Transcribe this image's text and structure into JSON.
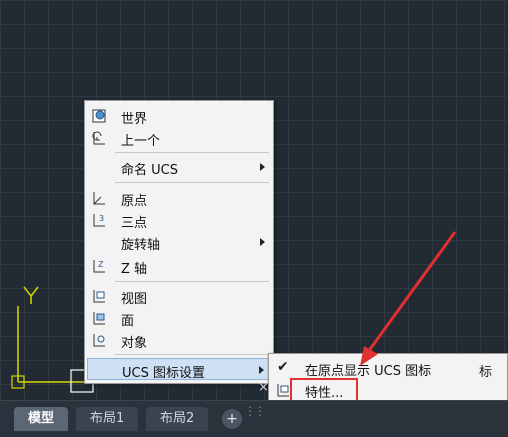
{
  "canvas": {
    "ucs_axis_label": "Y"
  },
  "context_menu": {
    "items": [
      {
        "label": "世界",
        "icon": "ucs-world-icon"
      },
      {
        "label": "上一个",
        "icon": "ucs-previous-icon"
      },
      {
        "label": "命名 UCS",
        "submenu": true
      },
      {
        "label": "原点",
        "icon": "ucs-origin-icon"
      },
      {
        "label": "三点",
        "icon": "ucs-3point-icon"
      },
      {
        "label": "旋转轴",
        "submenu": true
      },
      {
        "label": "Z 轴",
        "icon": "ucs-zaxis-icon"
      },
      {
        "label": "视图",
        "icon": "ucs-view-icon"
      },
      {
        "label": "面",
        "icon": "ucs-face-icon"
      },
      {
        "label": "对象",
        "icon": "ucs-object-icon"
      },
      {
        "label": "UCS 图标设置",
        "submenu": true,
        "highlighted": true
      }
    ]
  },
  "submenu": {
    "items": [
      {
        "label": "在原点显示 UCS 图标",
        "checked": true
      },
      {
        "label": "特性...",
        "icon": "properties-icon"
      }
    ],
    "partial_text": "标"
  },
  "annotation": {
    "arrow_color": "#e03030",
    "box_color": "#e03030"
  },
  "tabs": {
    "items": [
      "模型",
      "布局1",
      "布局2"
    ],
    "active": "模型",
    "add_label": "+"
  },
  "panel": {
    "close_glyph": "×"
  }
}
